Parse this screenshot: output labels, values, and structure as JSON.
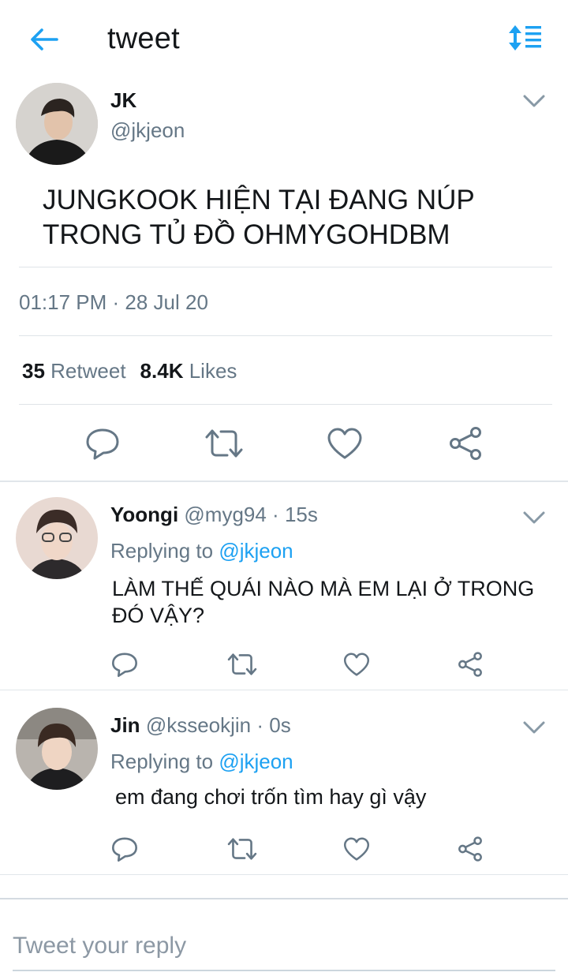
{
  "header": {
    "title": "tweet"
  },
  "tweet": {
    "name": "JK",
    "handle": "@jkjeon",
    "text": "JUNGKOOK HIỆN TẠI ĐANG NÚP TRONG TỦ ĐỒ OHMYGOHDBM",
    "timestamp": "01:17 PM · 28 Jul 20",
    "retweets_count": "35",
    "retweets_label": "Retweet",
    "likes_count": "8.4K",
    "likes_label": "Likes"
  },
  "replies": [
    {
      "name": "Yoongi",
      "handle_time": "@myg94 · 15s",
      "replying_prefix": "Replying to",
      "replying_to": "@jkjeon",
      "text": "LÀM THẾ QUÁI NÀO MÀ EM LẠI Ở TRONG ĐÓ VẬY?"
    },
    {
      "name": "Jin",
      "handle_time": "@ksseokjin · 0s",
      "replying_prefix": "Replying to",
      "replying_to": "@jkjeon",
      "text": "em đang chơi trốn tìm hay gì vậy"
    }
  ],
  "compose": {
    "placeholder": "Tweet your reply"
  },
  "colors": {
    "accent": "#1da1f2",
    "secondary_text": "#657786",
    "icon": "#657786"
  },
  "icons": [
    "back-arrow-icon",
    "sort-icon",
    "chevron-down-icon",
    "reply-icon",
    "retweet-icon",
    "like-icon",
    "share-icon"
  ]
}
